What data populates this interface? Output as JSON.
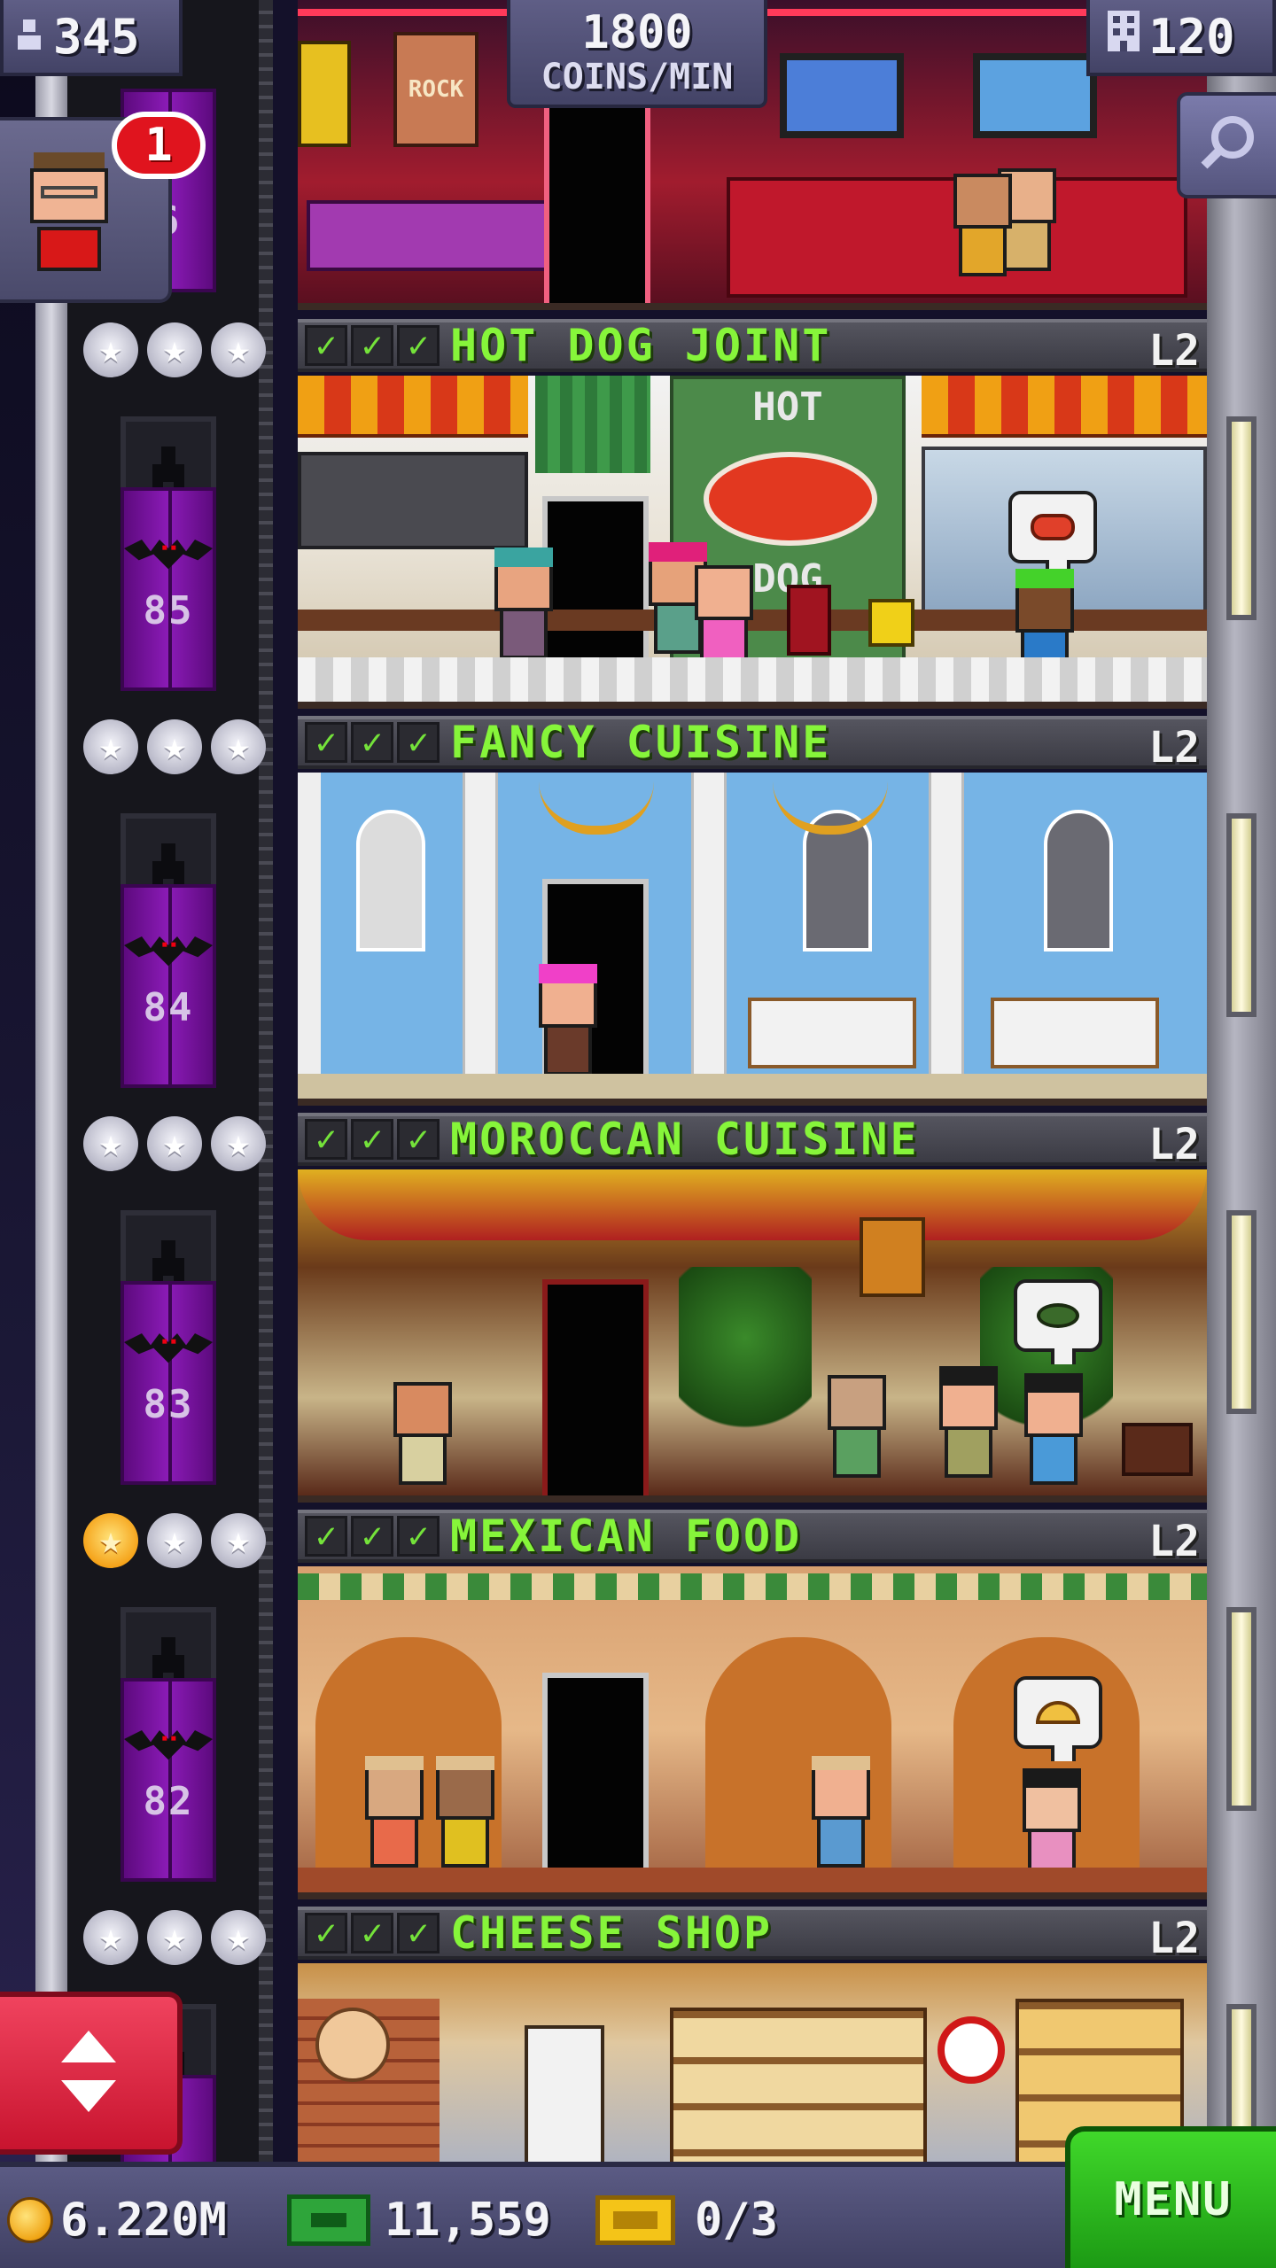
{
  "hud": {
    "population": "345",
    "coins_rate_value": "1800",
    "coins_rate_unit": "COINS/MIN",
    "floor_count": "120"
  },
  "notification": {
    "badge": "1"
  },
  "top_floor": {
    "elevator_number": "6"
  },
  "floors": [
    {
      "name": "HOT DOG JOINT",
      "level": "L2",
      "elevator_number": "85",
      "stars": 0,
      "bubble_icon": "hotdog-icon"
    },
    {
      "name": "FANCY CUISINE",
      "level": "L2",
      "elevator_number": "84",
      "stars": 0,
      "bubble_icon": ""
    },
    {
      "name": "MOROCCAN CUISINE",
      "level": "L2",
      "elevator_number": "83",
      "stars": 0,
      "bubble_icon": "bowl-icon"
    },
    {
      "name": "MEXICAN FOOD",
      "level": "L2",
      "elevator_number": "82",
      "stars": 1,
      "bubble_icon": "taco-icon"
    },
    {
      "name": "CHEESE SHOP",
      "level": "L2",
      "elevator_number": "",
      "stars": 0,
      "bubble_icon": ""
    }
  ],
  "scene_text": {
    "rock_sign": "ROCK",
    "hot_dog_sign_1": "HOT",
    "hot_dog_sign_2": "DOG"
  },
  "bottom_bar": {
    "coins": "6.220M",
    "bux": "11,559",
    "tickets": "0/3",
    "menu_label": "MENU"
  },
  "colors": {
    "floor_name": "#86f53a",
    "elevator_car": "#8b1bb7",
    "menu_button": "#2fb81e",
    "elevator_button": "#e12a47"
  }
}
